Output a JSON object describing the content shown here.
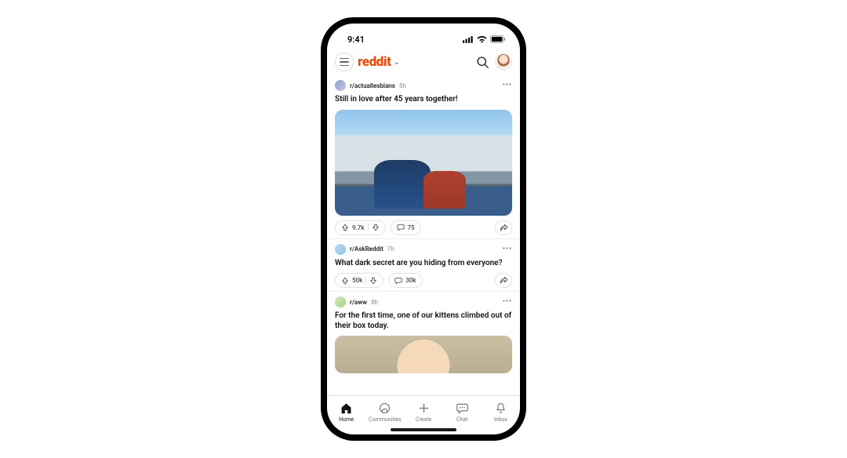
{
  "status": {
    "time": "9:41"
  },
  "header": {
    "logo": "reddit"
  },
  "feed": [
    {
      "subreddit": "r/actuallesbians",
      "age": "5h",
      "title": "Still in love after 45 years together!",
      "upvotes": "9.7k",
      "comments": "75",
      "has_image": true
    },
    {
      "subreddit": "r/AskReddit",
      "age": "7h",
      "title": "What dark secret are you hiding from everyone?",
      "upvotes": "50k",
      "comments": "30k",
      "has_image": false
    },
    {
      "subreddit": "r/aww",
      "age": "8h",
      "title": "For the first time, one of our kittens climbed out of their box today.",
      "has_image": true
    }
  ],
  "tabs": {
    "home": "Home",
    "communities": "Communities",
    "create": "Create",
    "chat": "Chat",
    "inbox": "Inbox"
  }
}
